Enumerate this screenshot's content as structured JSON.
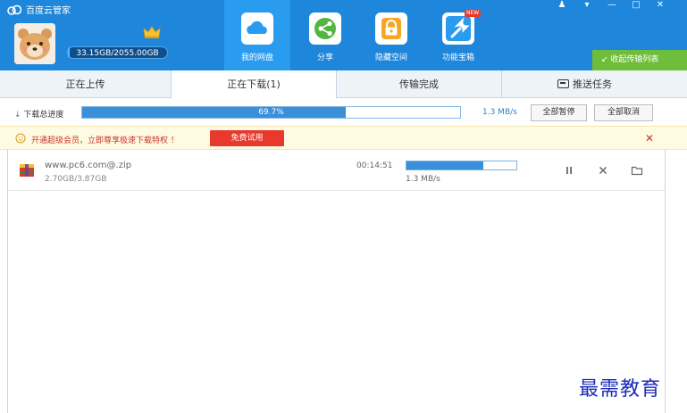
{
  "app": {
    "title": "百度云管家",
    "brand_color": "#1e86db",
    "logo_icon": "baidu-cloud-icon"
  },
  "account": {
    "quota_text": "33.15GB/2055.00GB",
    "quota_used_fraction": 0.016,
    "avatar_icon": "bear-avatar-icon",
    "vip_icon": "crown-icon"
  },
  "nav": [
    {
      "label": "我的网盘",
      "icon": "cloud-icon",
      "active": true
    },
    {
      "label": "分享",
      "icon": "share-icon",
      "active": false
    },
    {
      "label": "隐藏空间",
      "icon": "lock-icon",
      "active": false
    },
    {
      "label": "功能宝箱",
      "icon": "toolbox-icon",
      "active": false,
      "badge": "NEW"
    }
  ],
  "window": {
    "buttons": [
      {
        "name": "skin-button",
        "glyph": "♟"
      },
      {
        "name": "menu-button",
        "glyph": "▾"
      },
      {
        "name": "minimize-button",
        "glyph": "—"
      },
      {
        "name": "maximize-button",
        "glyph": "□"
      },
      {
        "name": "close-button",
        "glyph": "✕"
      }
    ],
    "collapse_label": "收起传输列表"
  },
  "tabs": [
    {
      "label": "正在上传",
      "active": false
    },
    {
      "label": "正在下载(1)",
      "active": true
    },
    {
      "label": "传输完成",
      "active": false
    },
    {
      "label": "推送任务",
      "active": false,
      "icon": "push-task-icon"
    }
  ],
  "progress": {
    "label": "下载总进度",
    "percent_text": "69.7%",
    "percent": 69.7,
    "speed": "1.3 MB/s",
    "pause_all": "全部暂停",
    "cancel_all": "全部取消"
  },
  "promo": {
    "text": "开通超级会员，立即尊享极速下载特权 ！",
    "trial_button": "免费试用",
    "close_glyph": "✕"
  },
  "downloads": [
    {
      "name": "www.pc6.com@.zip",
      "size": "2.70GB/3.87GB",
      "time_left": "00:14:51",
      "progress_fraction": 0.697,
      "speed": "1.3 MB/s",
      "icon": "zip-file-icon"
    }
  ],
  "watermark": "最需教育"
}
